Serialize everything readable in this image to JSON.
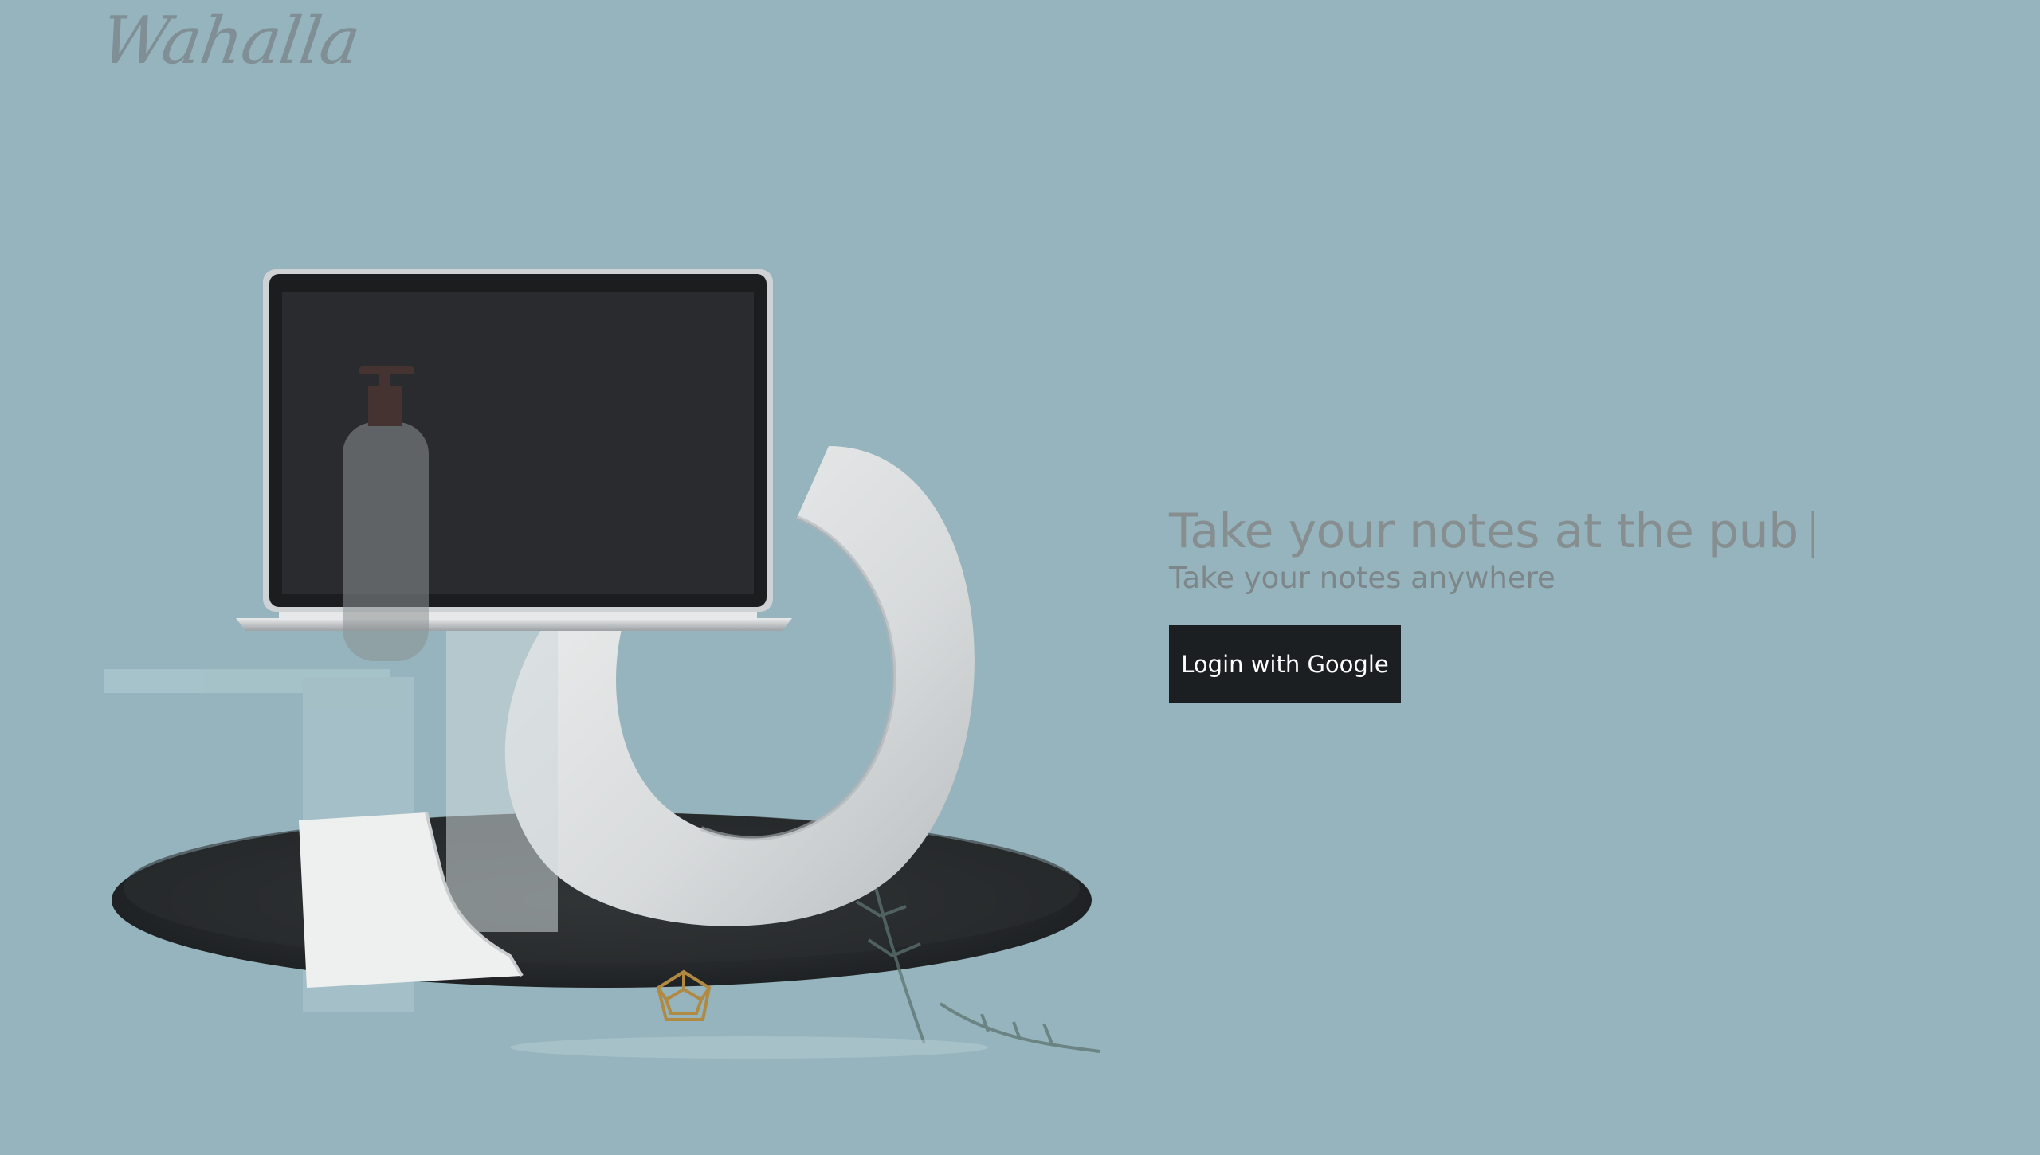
{
  "brand": {
    "logo_text": "Wahalla"
  },
  "hero": {
    "headline": "Take your notes at the pub",
    "cursor": "|",
    "subline": "Take your notes anywhere"
  },
  "auth": {
    "login_label": "Login with Google"
  },
  "colors": {
    "background": "#96b4bd",
    "button": "#1c1f21",
    "headline_text": "#868e90"
  }
}
